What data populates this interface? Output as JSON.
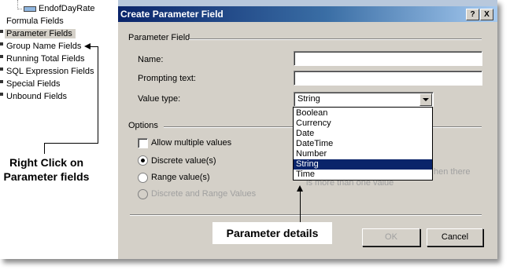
{
  "explorer": {
    "top_item": "EndofDayRate",
    "items": [
      {
        "label": "Formula Fields",
        "selected": false
      },
      {
        "label": "Parameter Fields",
        "selected": true
      },
      {
        "label": "Group Name Fields",
        "selected": false
      },
      {
        "label": "Running Total Fields",
        "selected": false
      },
      {
        "label": "SQL Expression Fields",
        "selected": false
      },
      {
        "label": "Special Fields",
        "selected": false
      },
      {
        "label": "Unbound Fields",
        "selected": false
      }
    ]
  },
  "annotations": {
    "left_line1": "Right Click on",
    "left_line2": "Parameter fields",
    "bottom": "Parameter details"
  },
  "dialog": {
    "title": "Create Parameter Field",
    "help_button": "?",
    "close_button": "X",
    "section_parameter": "Parameter Field",
    "name_label": "Name:",
    "name_value": "",
    "prompt_label": "Prompting text:",
    "prompt_value": "",
    "value_type_label": "Value type:",
    "value_type_selected": "String",
    "value_type_options": [
      "Boolean",
      "Currency",
      "Date",
      "DateTime",
      "Number",
      "String",
      "Time"
    ],
    "highlighted_option": "String",
    "options_label": "Options",
    "allow_multiple_label": "Allow multiple values",
    "allow_multiple_checked": false,
    "discrete_label": "Discrete value(s)",
    "range_label": "Range value(s)",
    "discrete_range_label": "Discrete and Range Values",
    "hint_partial_1": "hen there",
    "hint_partial_2": "is more than one value",
    "ok_label": "OK",
    "cancel_label": "Cancel"
  }
}
